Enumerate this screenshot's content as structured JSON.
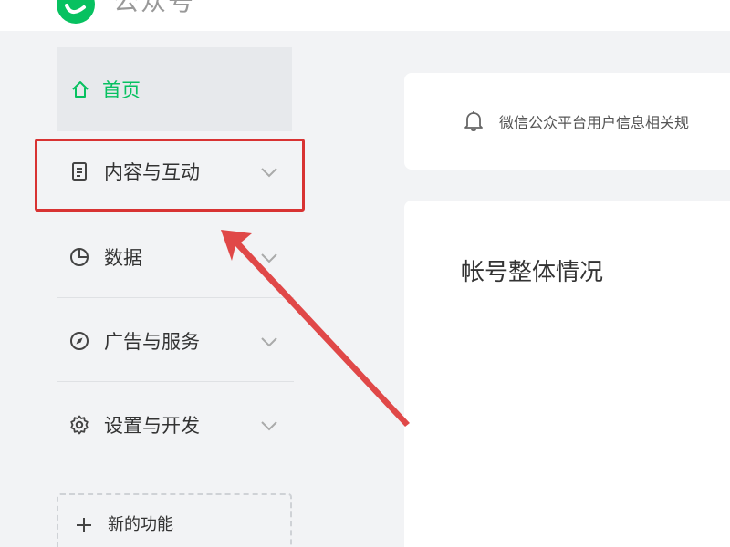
{
  "header": {
    "app_title": "公众号",
    "logo_icon": "wechat-logo-icon",
    "brand_color": "#07c160"
  },
  "sidebar": {
    "home": {
      "label": "首页",
      "icon": "home-icon"
    },
    "items": [
      {
        "label": "内容与互动",
        "icon": "document-icon",
        "highlighted": true
      },
      {
        "label": "数据",
        "icon": "pie-chart-icon"
      },
      {
        "label": "广告与服务",
        "icon": "compass-icon"
      },
      {
        "label": "设置与开发",
        "icon": "gear-icon"
      }
    ],
    "new_feature": {
      "label": "新的功能",
      "icon": "plus-icon"
    }
  },
  "notice": {
    "text": "微信公众平台用户信息相关规",
    "icon": "bell-icon"
  },
  "main": {
    "title": "帐号整体情况"
  },
  "annotation": {
    "highlight_color": "#d83232",
    "arrow_color": "#e04848"
  }
}
